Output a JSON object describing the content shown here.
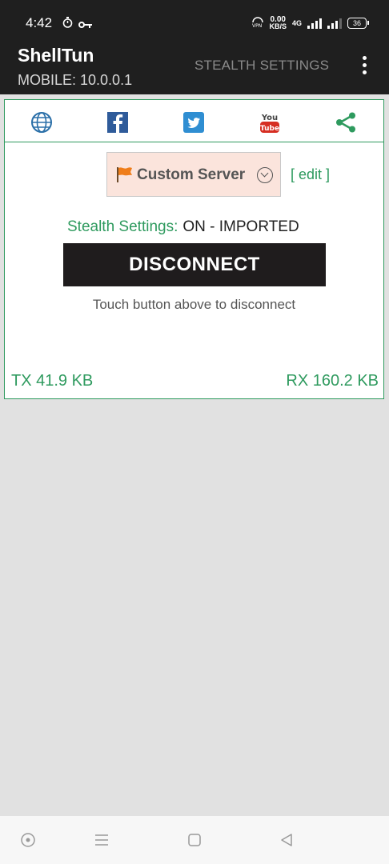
{
  "status_bar": {
    "time": "4:42",
    "speed_value": "0.00",
    "speed_unit": "KB/S",
    "network": "4G",
    "battery": "36"
  },
  "app_bar": {
    "title": "ShellTun",
    "subtitle": "MOBILE: 10.0.0.1",
    "action": "STEALTH SETTINGS"
  },
  "social": [
    "globe-icon",
    "facebook-icon",
    "twitter-icon",
    "youtube-icon",
    "share-icon"
  ],
  "server": {
    "label": "Custom Server",
    "edit": "[ edit ]"
  },
  "stealth": {
    "label": "Stealth Settings:",
    "value": "ON - IMPORTED"
  },
  "button": {
    "label": "DISCONNECT",
    "hint": "Touch button above to disconnect"
  },
  "traffic": {
    "tx": "TX 41.9 KB",
    "rx": "RX 160.2 KB"
  },
  "colors": {
    "accent": "#2e9a5e",
    "bar": "#1f1f1f",
    "button": "#1f1c1d",
    "server_bg": "#fbe4dc",
    "background": "#e1e1e1"
  }
}
